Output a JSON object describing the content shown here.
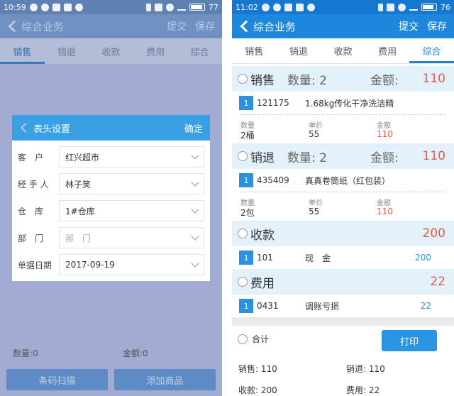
{
  "left": {
    "status": {
      "time": "10:59",
      "battery": "77"
    },
    "appbar": {
      "title": "综合业务",
      "submit": "提交",
      "save": "保存"
    },
    "tabs": [
      "销售",
      "销退",
      "收款",
      "费用",
      "综合"
    ],
    "dialog": {
      "title": "表头设置",
      "confirm": "确定",
      "rows": [
        {
          "label": "客　户",
          "value": "红兴超市",
          "placeholder": ""
        },
        {
          "label": "经 手 人",
          "value": "林子笑",
          "placeholder": ""
        },
        {
          "label": "仓　库",
          "value": "1#仓库",
          "placeholder": ""
        },
        {
          "label": "部　门",
          "value": "",
          "placeholder": "部　门"
        },
        {
          "label": "单据日期",
          "value": "2017-09-19",
          "placeholder": ""
        }
      ]
    },
    "footer": {
      "qty": "数量:0",
      "amount": "金额:0"
    },
    "buttons": {
      "scan": "条码扫描",
      "add": "添加商品"
    }
  },
  "right": {
    "status": {
      "time": "11:02",
      "battery": "76"
    },
    "appbar": {
      "title": "综合业务",
      "submit": "提交",
      "save": "保存"
    },
    "tabs": [
      "销售",
      "销退",
      "收款",
      "费用",
      "综合"
    ],
    "sales": {
      "title": "销售",
      "qty": "数量: 2",
      "amount_label": "金额:",
      "amount": "110",
      "item": {
        "index": "1",
        "code": "121175",
        "name": "1.68kg传化干净洗洁精"
      },
      "detail": {
        "qty_label": "数量",
        "qty": "2桶",
        "price_label": "单价",
        "price": "55",
        "amt_label": "金额",
        "amt": "110"
      }
    },
    "returns": {
      "title": "销退",
      "qty": "数量: 2",
      "amount_label": "金额:",
      "amount": "110",
      "item": {
        "index": "1",
        "code": "435409",
        "name": "真真卷筒纸（红包装）"
      },
      "detail": {
        "qty_label": "数量",
        "qty": "2包",
        "price_label": "单价",
        "price": "55",
        "amt_label": "金额",
        "amt": "110"
      }
    },
    "receipts": {
      "title": "收款",
      "amount": "200",
      "item": {
        "index": "1",
        "code": "101",
        "name": "现　金",
        "amount": "200"
      }
    },
    "expenses": {
      "title": "费用",
      "amount": "22",
      "item": {
        "index": "1",
        "code": "0431",
        "name": "调账亏损",
        "amount": "22"
      }
    },
    "summary": {
      "total_label": "合计",
      "print": "打印",
      "sales": "销售: 110",
      "returns": "销退: 110",
      "receipts": "收款: 200",
      "expenses": "费用: 22"
    }
  }
}
